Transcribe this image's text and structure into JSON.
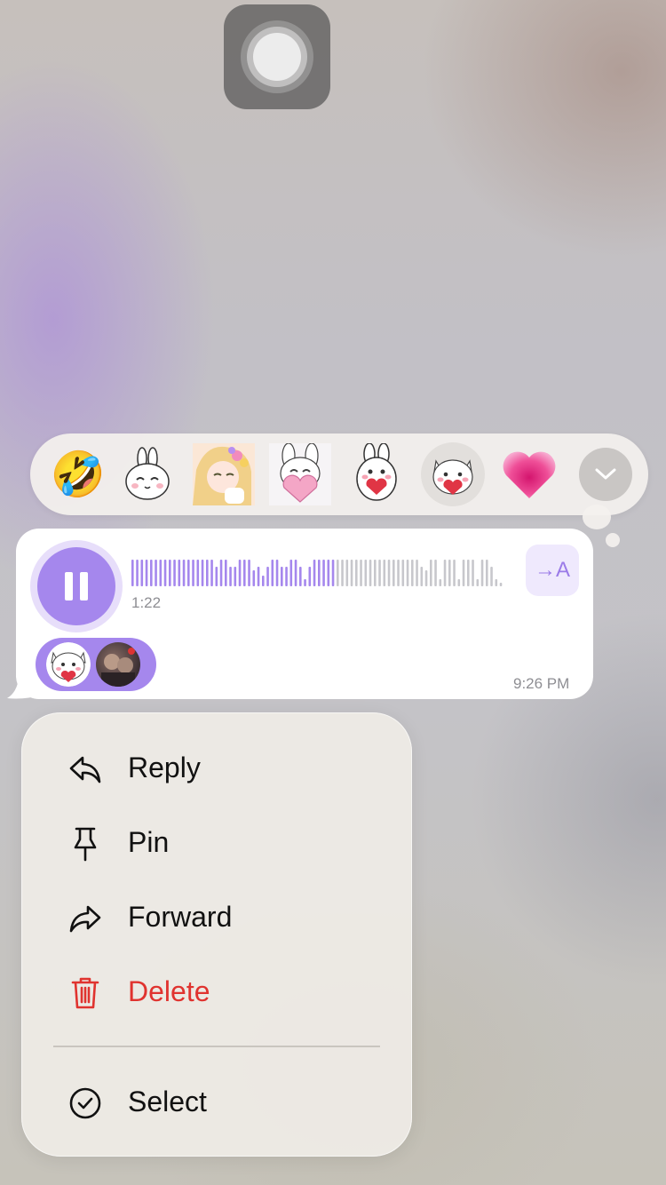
{
  "reactions": [
    {
      "icon": "rofl-emoji-icon",
      "label": "🤣"
    },
    {
      "icon": "bunny-sticker-icon"
    },
    {
      "icon": "anime-girl-sticker-icon"
    },
    {
      "icon": "bunny-heart-sticker-icon"
    },
    {
      "icon": "white-bunny-heart-sticker-icon"
    },
    {
      "icon": "cat-heart-sticker-icon",
      "selected": true
    },
    {
      "icon": "pink-heart-icon",
      "label": "💗"
    }
  ],
  "voice_message": {
    "duration": "1:22",
    "timestamp": "9:26 PM",
    "transcribe_label": "→A",
    "played_fraction": 0.55
  },
  "menu": {
    "items": [
      {
        "label": "Reply",
        "icon": "reply-icon"
      },
      {
        "label": "Pin",
        "icon": "pin-icon"
      },
      {
        "label": "Forward",
        "icon": "forward-icon"
      },
      {
        "label": "Delete",
        "icon": "trash-icon",
        "danger": true
      },
      {
        "label": "Select",
        "icon": "select-check-icon"
      }
    ]
  },
  "colors": {
    "accent": "#a587ed",
    "waveform_played": "#a587ed",
    "waveform_unplayed": "#c7c7cc",
    "danger": "#e0332f"
  }
}
